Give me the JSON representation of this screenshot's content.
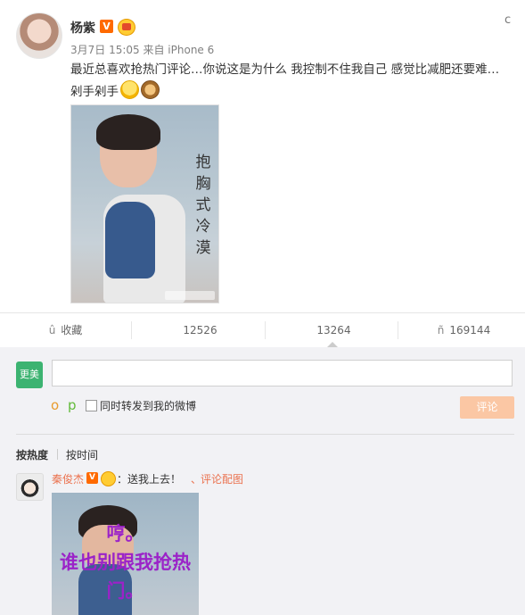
{
  "post": {
    "username": "杨紫",
    "v_badge": "V",
    "menu_icon": "c",
    "meta": "3月7日 15:05 来自 iPhone 6",
    "text_line1": "最近总喜欢抢热门评论…你说这是为什么 我控制不住我自己 感觉比减肥还要难…",
    "text_line2": "剁手剁手",
    "image_vertical_text": "抱胸式冷漠"
  },
  "actions": {
    "favorite_icon": "û",
    "favorite_label": "收藏",
    "repost_icon": "",
    "repost_count": "12526",
    "comment_icon": "",
    "comment_count": "13264",
    "like_icon": "ñ",
    "like_count": "169144"
  },
  "composer": {
    "my_avatar_text": "更美",
    "input_value": "",
    "emoji_button": "o",
    "picture_button": "p",
    "repost_checkbox_label": "同时转发到我的微博",
    "submit_label": "评论"
  },
  "sort": {
    "hot": "按热度",
    "time": "按时间"
  },
  "comment": {
    "username": "秦俊杰",
    "v_badge": "V",
    "text": "：送我上去！",
    "image_icon": "、",
    "image_link": "评论配图",
    "image_overlay": "哼。\n谁也别跟我抢热\n门。"
  },
  "colors": {
    "accent": "#eb7350",
    "submit_disabled": "#fbc7a4",
    "overlay_purple": "#9b23c8",
    "v_badge": "#ff6a00"
  }
}
